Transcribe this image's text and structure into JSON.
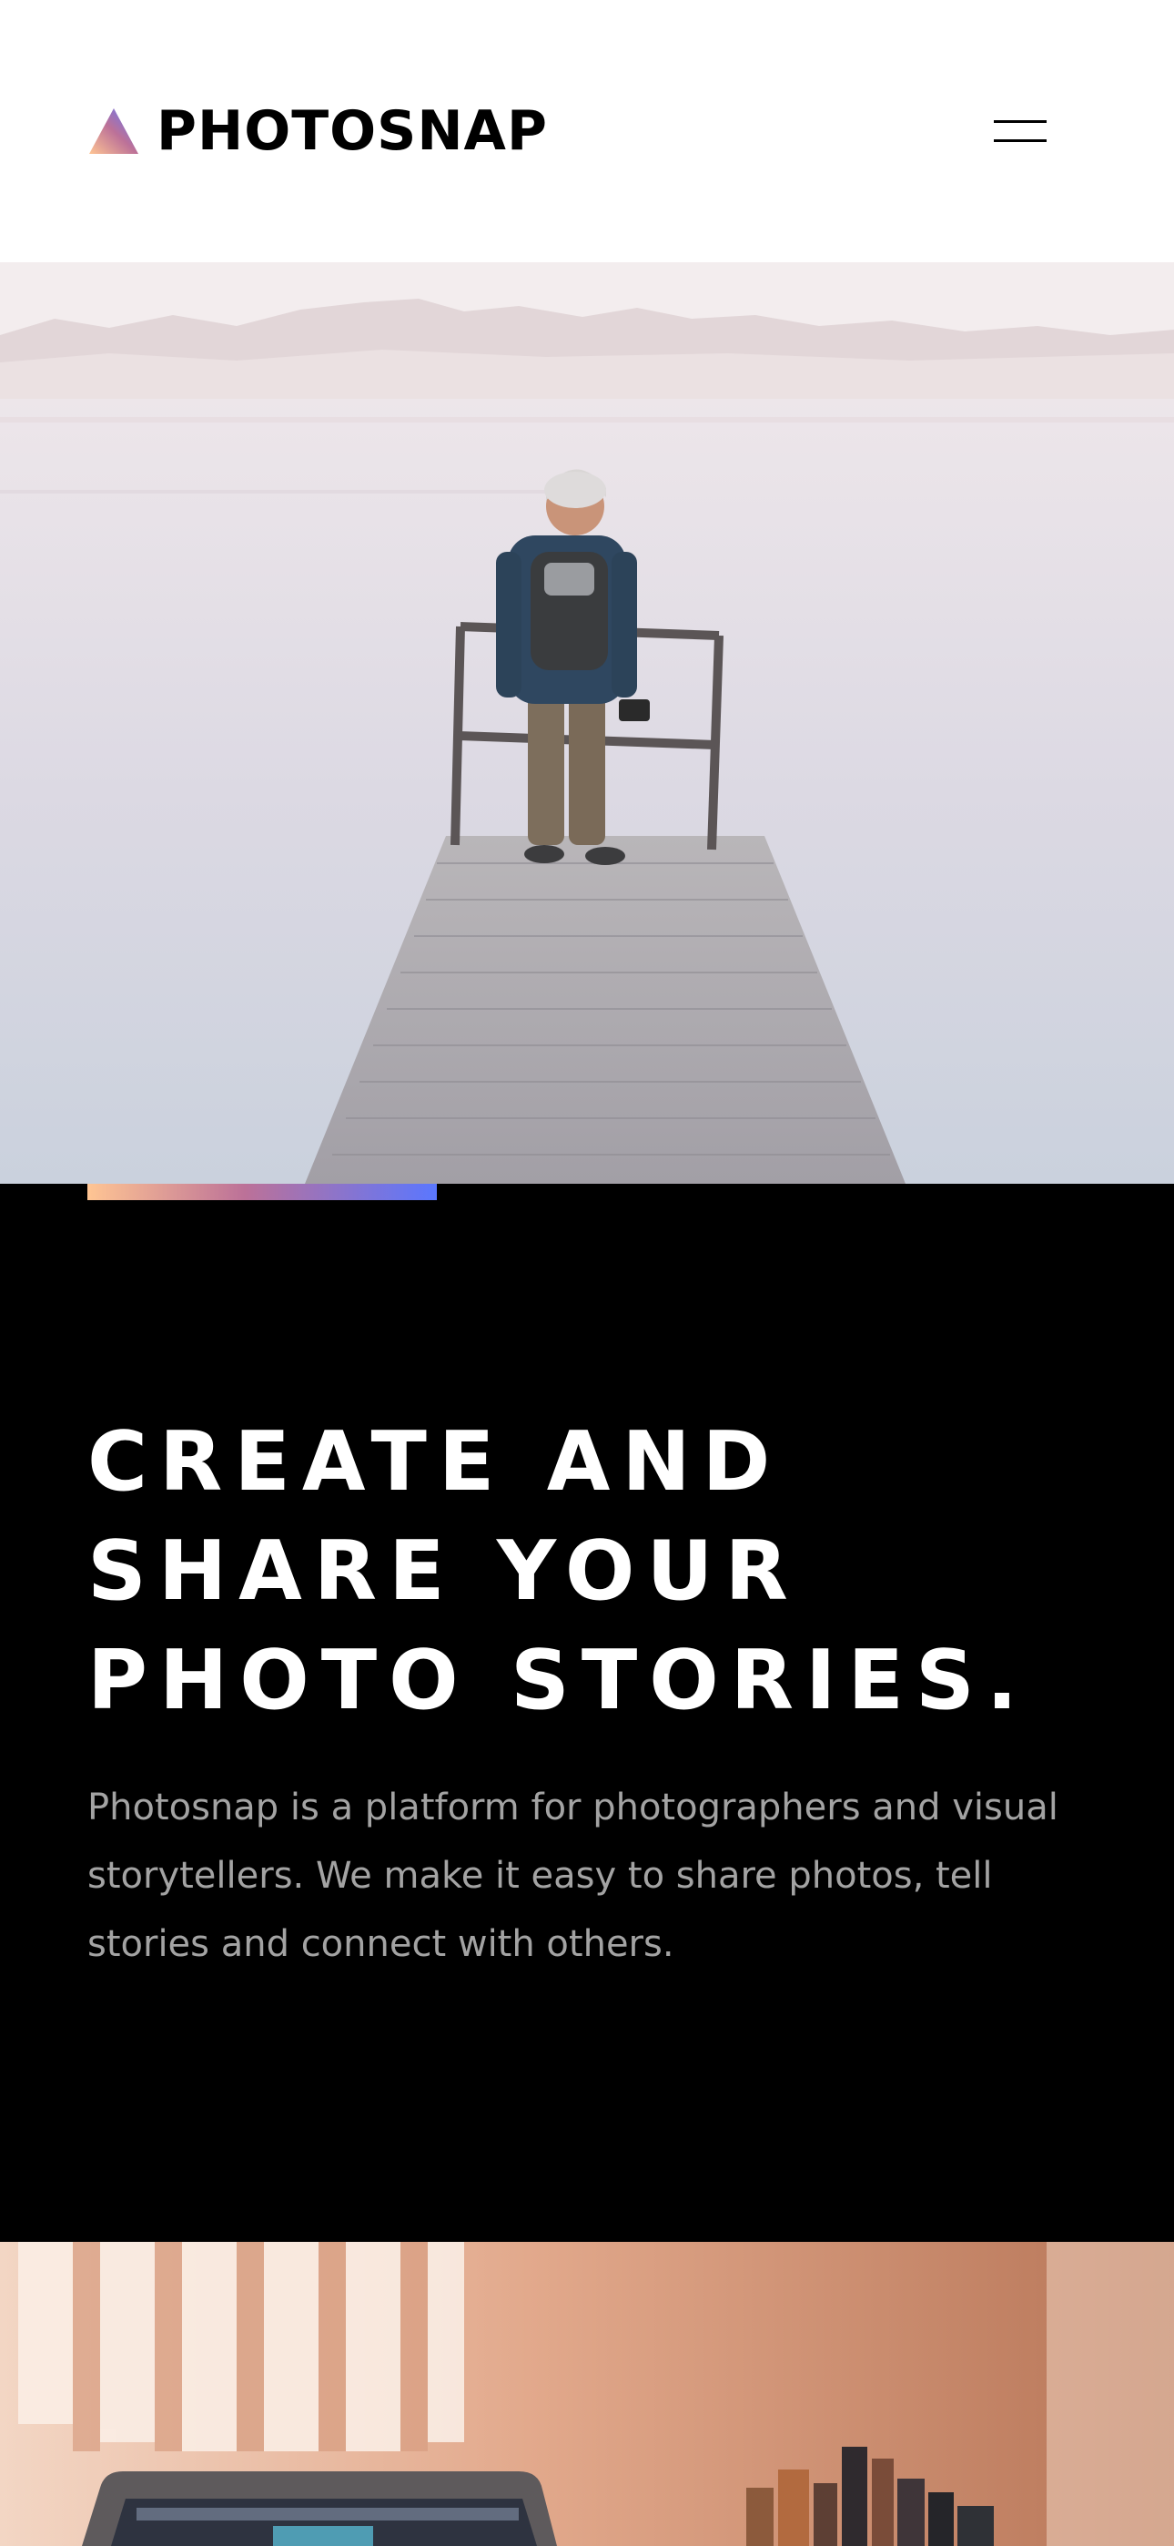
{
  "header": {
    "brand_name": "PHOTOSNAP",
    "menu_icon": "hamburger-menu-icon"
  },
  "hero": {
    "image_subject": "person with backpack and camera standing on a wooden pier over a misty lake"
  },
  "intro": {
    "title_lines": [
      "CREATE AND",
      "SHARE YOUR",
      "PHOTO STORIES."
    ],
    "description": "Photosnap is a platform for photographers and visual storytellers. We make it easy to share photos, tell stories and connect with others."
  },
  "next_section": {
    "image_subject": "laptop on a desk with books in a warm-lit room"
  },
  "colors": {
    "gradient_start": "#ffc593",
    "gradient_mid": "#bc7198",
    "gradient_end": "#5a77ff",
    "intro_background": "#000000",
    "intro_text": "#a3a3a3"
  }
}
